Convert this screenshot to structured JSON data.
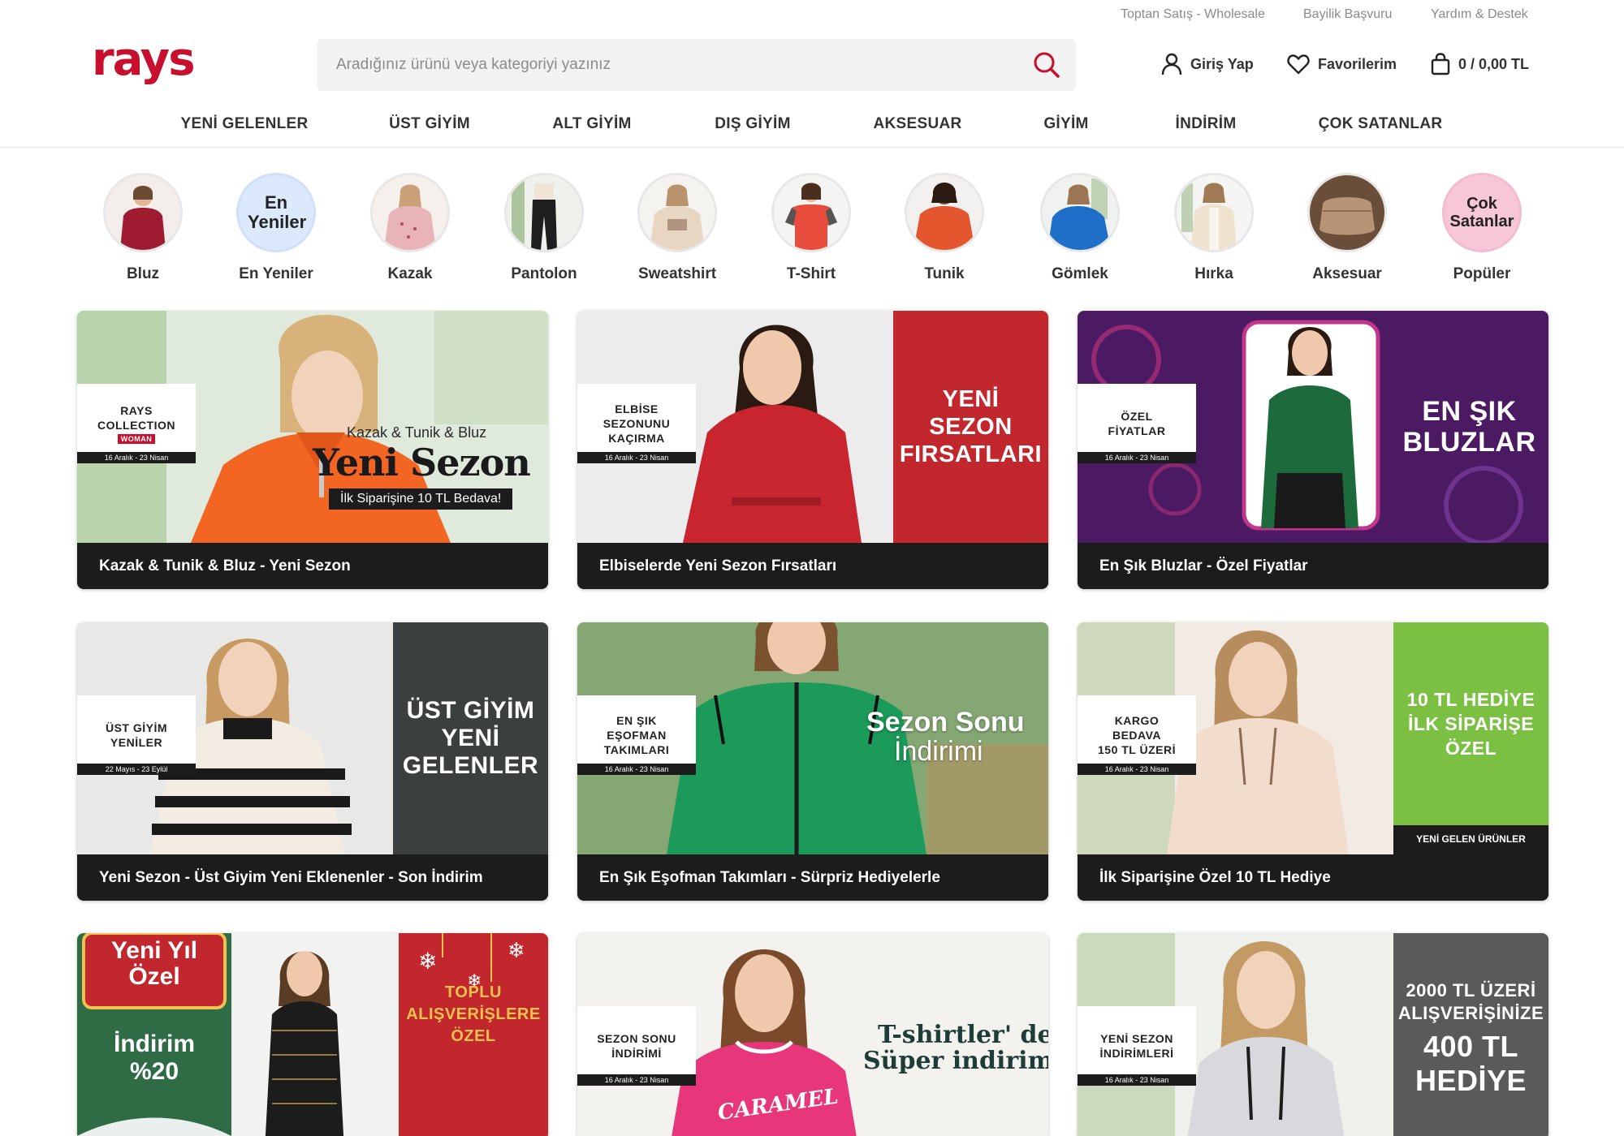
{
  "utility_links": [
    "Toptan Satış - Wholesale",
    "Bayilik Başvuru",
    "Yardım & Destek"
  ],
  "brand": {
    "logo_text": "rays",
    "color": "#c8102e"
  },
  "search": {
    "placeholder": "Aradığınız ürünü veya kategoriyi yazınız"
  },
  "header": {
    "login_label": "Giriş Yap",
    "favorites_label": "Favorilerim",
    "cart_label": "0 / 0,00 TL"
  },
  "nav": [
    "YENİ GELENLER",
    "ÜST GİYİM",
    "ALT GİYİM",
    "DIŞ GİYİM",
    "AKSESUAR",
    "GİYİM",
    "İNDİRİM",
    "ÇOK SATANLAR"
  ],
  "stories": [
    {
      "label": "Bluz",
      "color": "#9e1b32",
      "icon": "blouse-photo"
    },
    {
      "label": "En Yeniler",
      "color": "#dce8fb",
      "text": "En Yeniler",
      "text_color": "#333333",
      "icon": "new-arrivals-badge"
    },
    {
      "label": "Kazak",
      "color": "#e8b4b8",
      "icon": "sweater-photo"
    },
    {
      "label": "Pantolon",
      "color": "#1e1e1e",
      "icon": "trousers-photo"
    },
    {
      "label": "Sweatshirt",
      "color": "#e9d6c2",
      "icon": "sweatshirt-photo"
    },
    {
      "label": "T-Shirt",
      "color": "#e74c3c",
      "icon": "tshirt-photo"
    },
    {
      "label": "Tunik",
      "color": "#e4572e",
      "icon": "tunic-photo"
    },
    {
      "label": "Gömlek",
      "color": "#1f6fc8",
      "icon": "shirt-photo"
    },
    {
      "label": "Hırka",
      "color": "#efe3cf",
      "icon": "cardigan-photo"
    },
    {
      "label": "Aksesuar",
      "color": "#b59478",
      "icon": "bag-photo"
    },
    {
      "label": "Popüler",
      "color": "#f7c6d9",
      "text": "Çok Satanlar",
      "text_color": "#333333",
      "icon": "best-sellers-badge"
    }
  ],
  "banners": [
    {
      "caption": "Kazak & Tunik & Bluz - Yeni Sezon",
      "tag": "RAYS\nCOLLECTION",
      "tag_sub": "WOMAN",
      "tag_date": "16 Aralık - 23 Nisan",
      "overlay_small": "Kazak & Tunik & Bluz",
      "overlay_big": "Yeni Sezon",
      "overlay_strip": "İlk Siparişine 10 TL Bedava!",
      "bg": "#dfe9dc",
      "garment": "#f26522"
    },
    {
      "caption": "Elbiselerde Yeni Sezon Fırsatları",
      "tag": "ELBİSE\nSEZONUNU\nKAÇIRMA",
      "tag_date": "16 Aralık - 23 Nisan",
      "promo": "YENİ\nSEZON\nFIRSATLARI",
      "bg": "#ececec",
      "panel": "#c1272d",
      "garment": "#c8252f"
    },
    {
      "caption": "En Şık Bluzlar - Özel Fiyatlar",
      "tag": "ÖZEL\nFİYATLAR",
      "tag_date": "16 Aralık - 23 Nisan",
      "promo": "EN ŞIK\nBLUZLAR",
      "bg": "#4b1a63",
      "garment": "#1d6b3c"
    },
    {
      "caption": "Yeni Sezon - Üst Giyim Yeni Eklenenler - Son İndirim",
      "tag": "ÜST GİYİM\nYENİLER",
      "tag_date": "22 Mayıs - 23 Eylül",
      "promo": "ÜST GİYİM\nYENİ\nGELENLER",
      "bg": "#e8e8e6",
      "panel": "#3b3f40",
      "garment": "#f2ece2"
    },
    {
      "caption": "En Şık Eşofman Takımları - Sürpriz Hediyelerle",
      "tag": "EN ŞIK\nEŞOFMAN\nTAKIMLARI",
      "tag_date": "16 Aralık - 23 Nisan",
      "overlay_big": "Sezon Sonu",
      "overlay_small": "İndirimi",
      "bg": "#5c8a4a",
      "garment": "#1b9a5a"
    },
    {
      "caption": "İlk Siparişine Özel 10 TL Hediye",
      "tag": "KARGO\nBEDAVA\n150 TL ÜZERİ",
      "tag_date": "16 Aralık - 23 Nisan",
      "promo": "10 TL HEDİYE\nİLK SİPARİŞE\nÖZEL",
      "promo_footer": "YENİ GELEN ÜRÜNLER",
      "bg": "#f1ebe4",
      "panel": "#7bbf43",
      "garment": "#f2dccb"
    },
    {
      "left_title": "Yeni Yıl\nÖzel",
      "left_big": "İndirim\n%20",
      "promo": "TOPLU\nALIŞVERİŞLERE\nÖZEL",
      "bg": "#f2f2f0",
      "panel_left": "#2f6b45",
      "panel_right": "#c1272d",
      "accent": "#f2c14e"
    },
    {
      "tag": "SEZON SONU\nİNDİRİMİ",
      "tag_date": "16 Aralık - 23 Nisan",
      "overlay_big": "T-shirtler' de",
      "overlay_big2": "Süper indirim",
      "print_text": "CARAMEL",
      "bg": "#f4f2ee",
      "garment": "#e8367a"
    },
    {
      "tag": "YENİ SEZON\nİNDİRİMLERİ",
      "tag_date": "16 Aralık - 23 Nisan",
      "promo": "2000 TL ÜZERİ\nALIŞVERİŞİNİZE",
      "promo_big": "400 TL\nHEDİYE",
      "bg": "#eef0ec",
      "panel": "#5a5a5a",
      "garment": "#d7d9dc"
    }
  ]
}
